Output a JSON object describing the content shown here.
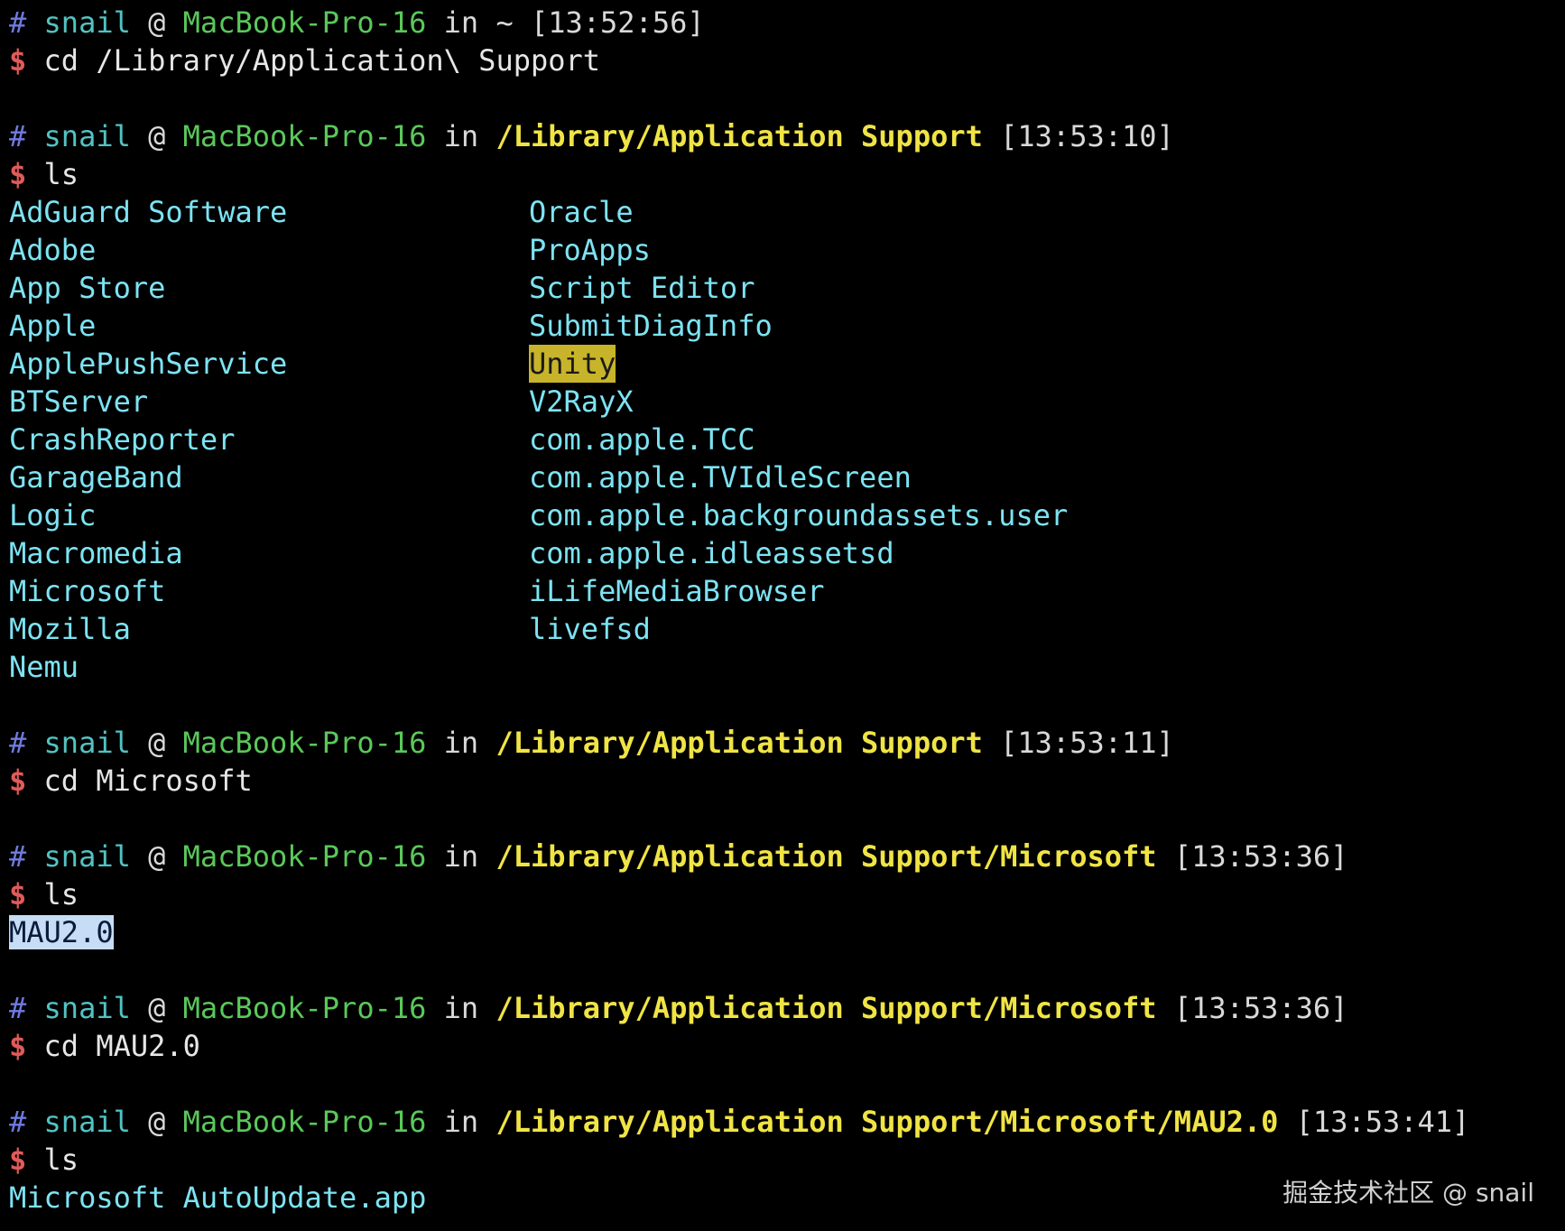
{
  "colors": {
    "background": "#000000",
    "prompt_hash": "#6f7be0",
    "user": "#52c3c3",
    "host": "#5ac85a",
    "path": "#f0e445",
    "dollar": "#e05a5a",
    "directory_entry": "#7de3f2",
    "highlight_yellow": "#c7b42a",
    "highlight_blue": "#c7dcf5"
  },
  "blocks": [
    {
      "prompt": {
        "hash": "#",
        "user": "snail",
        "at": "@",
        "host": "MacBook-Pro-16",
        "in": "in",
        "path": "~",
        "time": "[13:52:56]"
      },
      "command": {
        "dollar": "$",
        "text": "cd /Library/Application\\ Support"
      }
    },
    {
      "prompt": {
        "hash": "#",
        "user": "snail",
        "at": "@",
        "host": "MacBook-Pro-16",
        "in": "in",
        "path": "/Library/Application Support",
        "time": "[13:53:10]"
      },
      "command": {
        "dollar": "$",
        "text": "ls"
      },
      "listing_left": [
        "AdGuard Software",
        "Adobe",
        "App Store",
        "Apple",
        "ApplePushService",
        "BTServer",
        "CrashReporter",
        "GarageBand",
        "Logic",
        "Macromedia",
        "Microsoft",
        "Mozilla",
        "Nemu"
      ],
      "listing_right": [
        "Oracle",
        "ProApps",
        "Script Editor",
        "SubmitDiagInfo",
        "Unity",
        "V2RayX",
        "com.apple.TCC",
        "com.apple.TVIdleScreen",
        "com.apple.backgroundassets.user",
        "com.apple.idleassetsd",
        "iLifeMediaBrowser",
        "livefsd"
      ]
    },
    {
      "prompt": {
        "hash": "#",
        "user": "snail",
        "at": "@",
        "host": "MacBook-Pro-16",
        "in": "in",
        "path": "/Library/Application Support",
        "time": "[13:53:11]"
      },
      "command": {
        "dollar": "$",
        "text": "cd Microsoft"
      }
    },
    {
      "prompt": {
        "hash": "#",
        "user": "snail",
        "at": "@",
        "host": "MacBook-Pro-16",
        "in": "in",
        "path": "/Library/Application Support/Microsoft",
        "time": "[13:53:36]"
      },
      "command": {
        "dollar": "$",
        "text": "ls"
      },
      "listing": [
        "MAU2.0"
      ]
    },
    {
      "prompt": {
        "hash": "#",
        "user": "snail",
        "at": "@",
        "host": "MacBook-Pro-16",
        "in": "in",
        "path": "/Library/Application Support/Microsoft",
        "time": "[13:53:36]"
      },
      "command": {
        "dollar": "$",
        "text": "cd MAU2.0"
      }
    },
    {
      "prompt": {
        "hash": "#",
        "user": "snail",
        "at": "@",
        "host": "MacBook-Pro-16",
        "in": "in",
        "path": "/Library/Application Support/Microsoft/MAU2.0",
        "time": "[13:53:41]"
      },
      "command": {
        "dollar": "$",
        "text": "ls"
      },
      "listing": [
        "Microsoft AutoUpdate.app"
      ]
    }
  ],
  "watermark": "掘金技术社区 @ snail"
}
